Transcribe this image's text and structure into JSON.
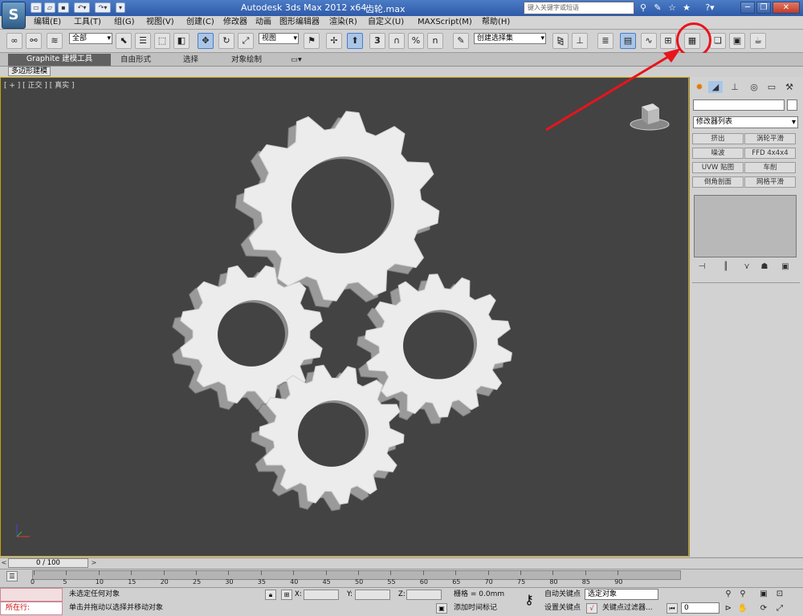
{
  "window": {
    "app_title": "Autodesk 3ds Max  2012 x64",
    "filename": "齿轮.max",
    "search_placeholder": "键入关键字或短语",
    "logo_text": "S"
  },
  "menu": [
    "编辑(E)",
    "工具(T)",
    "组(G)",
    "视图(V)",
    "创建(C)",
    "修改器",
    "动画",
    "图形编辑器",
    "渲染(R)",
    "自定义(U)",
    "MAXScript(M)",
    "帮助(H)"
  ],
  "toolbar": {
    "filter_combo": "全部",
    "refcoord_combo": "视图",
    "named_selection_combo": "创建选择集",
    "snap_label": "3",
    "percent_label": "%",
    "spinner_snap": "n"
  },
  "ribbon": {
    "tabs": [
      "Graphite 建模工具",
      "自由形式",
      "选择",
      "对象绘制"
    ],
    "subtab": "多边形建模"
  },
  "viewport": {
    "label": "[ + ] [ 正交 ] [ 真实 ]",
    "background": "#434343",
    "highlight": "#c8a400"
  },
  "command_panel": {
    "modifier_list": "修改器列表",
    "buttons": [
      "挤出",
      "涡轮平滑",
      "噪波",
      "FFD 4x4x4",
      "UVW 贴图",
      "车削",
      "倒角剖面",
      "网格平滑"
    ]
  },
  "timeslider": {
    "range_label": "0 / 100",
    "ticks": [
      "0",
      "5",
      "10",
      "15",
      "20",
      "25",
      "30",
      "35",
      "40",
      "45",
      "50",
      "55",
      "60",
      "65",
      "70",
      "75",
      "80",
      "85",
      "90"
    ]
  },
  "status": {
    "selection_text": "未选定任何对象",
    "prompt_text": "单击并拖动以选择并移动对象",
    "script_label": "所在行:",
    "x_label": "X:",
    "y_label": "Y:",
    "z_label": "Z:",
    "grid_text": "栅格 = 0.0mm",
    "add_time_tag": "添加时间标记",
    "auto_key": "自动关键点",
    "set_key": "设置关键点",
    "selected_combo": "选定对象",
    "key_filters": "关键点过滤器...",
    "frame_value": "0"
  },
  "annotation": {
    "color": "#e8141c"
  }
}
